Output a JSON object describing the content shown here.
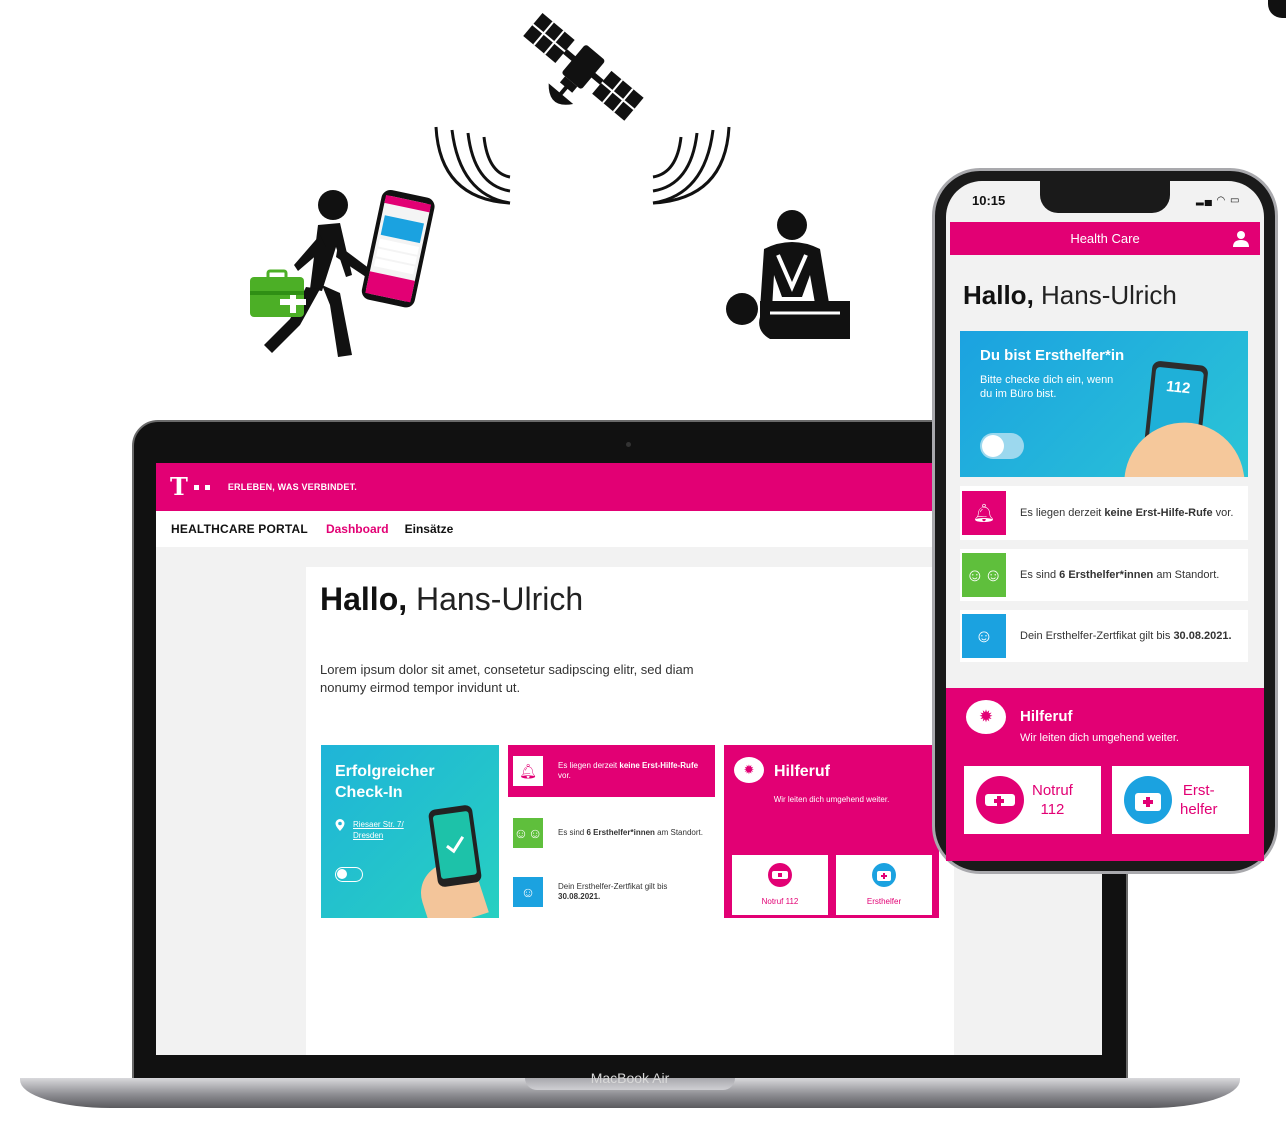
{
  "colors": {
    "brand": "#e20074",
    "teal": "#1fb4d8",
    "green": "#5fbf3c",
    "blue": "#1ba2e0"
  },
  "illustrations": {
    "satellite_icon": "satellite-icon",
    "runner_icon": "person-with-phone-and-first-aid-kit-icon",
    "cpr_icon": "cpr-icon"
  },
  "laptop": {
    "model_label": "MacBook Air",
    "header": {
      "logo": "T",
      "slogan": "ERLEBEN, WAS VERBINDET."
    },
    "nav": {
      "brand": "HEALTHCARE PORTAL",
      "items": [
        "Dashboard",
        "Einsätze"
      ]
    },
    "greeting": {
      "bold": "Hallo,",
      "name": " Hans-Ulrich"
    },
    "intro": "Lorem ipsum dolor sit amet, consetetur sadipscing elitr, sed diam nonumy eirmod tempor invidunt ut.",
    "checkin": {
      "title": "Erfolgreicher Check-In",
      "address_line1": "Riesaer Str. 7/",
      "address_line2": "Dresden"
    },
    "info": [
      {
        "pre": "Es liegen derzeit ",
        "bold": "keine Erst-Hilfe-Rufe",
        "post": " vor."
      },
      {
        "pre": "Es sind ",
        "bold": "6 Ersthelfer*innen",
        "post": " am Standort."
      },
      {
        "pre": "Dein Ersthelfer-Zertfikat gilt bis ",
        "bold": "30.08.2021.",
        "post": ""
      }
    ],
    "hilfe": {
      "title": "Hilferuf",
      "subtitle": "Wir leiten dich umgehend weiter.",
      "btn_notruf": "Notruf 112",
      "btn_ersthelfer": "Ersthelfer"
    }
  },
  "phone": {
    "time": "10:15",
    "status": "▂▄ ◠ ▭",
    "app_title": "Health Care",
    "greeting": {
      "bold": "Hallo,",
      "name": " Hans-Ulrich"
    },
    "hero": {
      "title": "Du bist Ersthelfer*in",
      "subtitle": "Bitte checke dich ein, wenn du im Büro bist.",
      "phone_number": "112"
    },
    "info": [
      {
        "pre": "Es liegen derzeit ",
        "bold": "keine Erst-Hilfe-Rufe",
        "post": " vor."
      },
      {
        "pre": "Es sind ",
        "bold": "6 Ersthelfer*innen",
        "post": " am Standort."
      },
      {
        "pre": "Dein Ersthelfer-Zertfikat gilt bis ",
        "bold": "30.08.2021.",
        "post": ""
      }
    ],
    "hilfe": {
      "title": "Hilferuf",
      "subtitle": "Wir leiten dich umgehend weiter.",
      "btn_notruf_l1": "Notruf",
      "btn_notruf_l2": "112",
      "btn_erst_l1": "Erst-",
      "btn_erst_l2": "helfer"
    }
  }
}
